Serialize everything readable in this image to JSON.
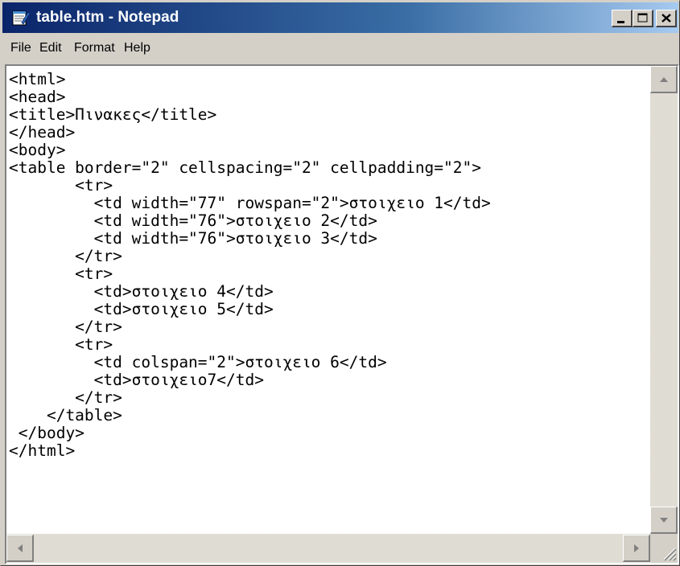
{
  "window": {
    "title": "table.htm - Notepad",
    "titlebar_color": "#0a246a",
    "controls": [
      "minimize-icon",
      "maximize-icon",
      "close-icon"
    ]
  },
  "menu": {
    "items": [
      "File",
      "Edit",
      "Format",
      "Help"
    ]
  },
  "editor": {
    "lines": [
      "<html>",
      "<head>",
      "<title>Πινακες</title>",
      "</head>",
      "<body>",
      "<table border=\"2\" cellspacing=\"2\" cellpadding=\"2\">",
      "       <tr>",
      "         <td width=\"77\" rowspan=\"2\">στοιχειο 1</td>",
      "         <td width=\"76\">στοιχειο 2</td>",
      "         <td width=\"76\">στοιχειο 3</td>",
      "       </tr>",
      "       <tr>",
      "         <td>στοιχειο 4</td>",
      "         <td>στοιχειο 5</td>",
      "       </tr>",
      "       <tr>",
      "         <td colspan=\"2\">στοιχειο 6</td>",
      "         <td>στοιχειο7</td>",
      "       </tr>",
      "    </table>",
      " </body>",
      "</html>"
    ]
  }
}
